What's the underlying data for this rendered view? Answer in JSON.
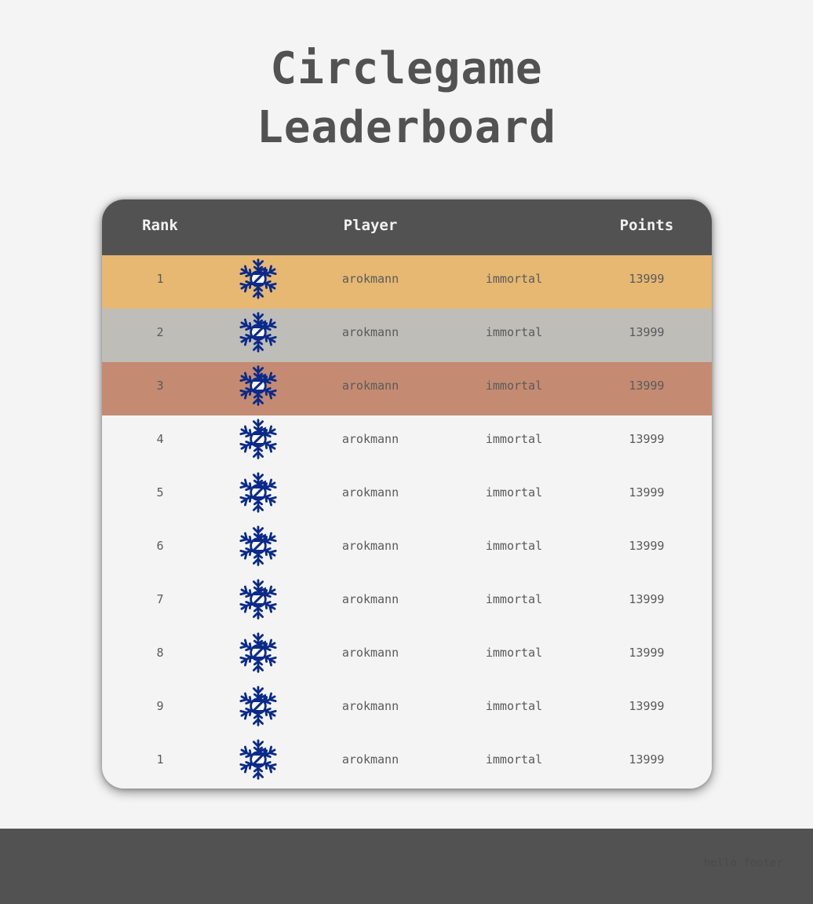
{
  "title": {
    "line1": "Circlegame",
    "line2": "Leaderboard"
  },
  "table": {
    "headers": {
      "rank": "Rank",
      "player": "Player",
      "points": "Points"
    },
    "rows": [
      {
        "rank": "1",
        "name": "arokmann",
        "title": "immortal",
        "points": "13999",
        "color": "#e6b872",
        "avatar_icon": "snowflake-logo-icon"
      },
      {
        "rank": "2",
        "name": "arokmann",
        "title": "immortal",
        "points": "13999",
        "color": "#bebdb8",
        "avatar_icon": "snowflake-logo-icon"
      },
      {
        "rank": "3",
        "name": "arokmann",
        "title": "immortal",
        "points": "13999",
        "color": "#c48b72",
        "avatar_icon": "snowflake-logo-icon"
      },
      {
        "rank": "4",
        "name": "arokmann",
        "title": "immortal",
        "points": "13999",
        "color": "#f4f4f4",
        "avatar_icon": "snowflake-logo-icon"
      },
      {
        "rank": "5",
        "name": "arokmann",
        "title": "immortal",
        "points": "13999",
        "color": "#f4f4f4",
        "avatar_icon": "snowflake-logo-icon"
      },
      {
        "rank": "6",
        "name": "arokmann",
        "title": "immortal",
        "points": "13999",
        "color": "#f4f4f4",
        "avatar_icon": "snowflake-logo-icon"
      },
      {
        "rank": "7",
        "name": "arokmann",
        "title": "immortal",
        "points": "13999",
        "color": "#f4f4f4",
        "avatar_icon": "snowflake-logo-icon"
      },
      {
        "rank": "8",
        "name": "arokmann",
        "title": "immortal",
        "points": "13999",
        "color": "#f4f4f4",
        "avatar_icon": "snowflake-logo-icon"
      },
      {
        "rank": "9",
        "name": "arokmann",
        "title": "immortal",
        "points": "13999",
        "color": "#f4f4f4",
        "avatar_icon": "snowflake-logo-icon"
      },
      {
        "rank": "1",
        "name": "arokmann",
        "title": "immortal",
        "points": "13999",
        "color": "#f4f4f4",
        "avatar_icon": "snowflake-logo-icon"
      }
    ]
  },
  "footer": {
    "text": "hello footer"
  },
  "colors": {
    "background": "#f4f4f4",
    "header": "#525252",
    "gold": "#e6b872",
    "silver": "#bebdb8",
    "bronze": "#c48b72",
    "avatar_blue": "#0a2a8a"
  }
}
